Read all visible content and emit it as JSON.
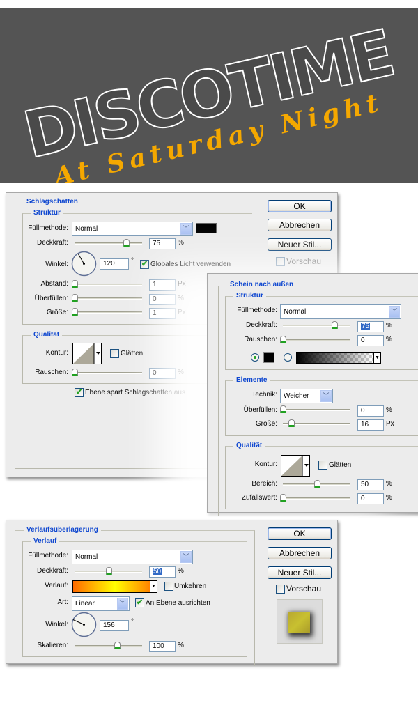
{
  "banner": {
    "title": "DISCOTIME",
    "subtitle": "At Saturday Night",
    "bg_color": "#545454",
    "subtitle_color": "#f5a800"
  },
  "buttons": {
    "ok": "OK",
    "cancel": "Abbrechen",
    "new_style": "Neuer Stil...",
    "preview": "Vorschau"
  },
  "drop_shadow": {
    "title": "Schlagschatten",
    "structure": "Struktur",
    "blend_mode_label": "Füllmethode:",
    "blend_mode": "Normal",
    "color": "#000000",
    "opacity_label": "Deckkraft:",
    "opacity": "75",
    "opacity_unit": "%",
    "angle_label": "Winkel:",
    "angle": "120",
    "angle_unit": "°",
    "global_light_label": "Globales Licht verwenden",
    "global_light": true,
    "distance_label": "Abstand:",
    "distance": "1",
    "distance_unit": "Px",
    "spread_label": "Überfüllen:",
    "spread": "0",
    "spread_unit": "%",
    "size_label": "Größe:",
    "size": "1",
    "size_unit": "Px",
    "quality": "Qualität",
    "contour_label": "Kontur:",
    "antialias_label": "Glätten",
    "antialias": false,
    "noise_label": "Rauschen:",
    "noise": "0",
    "noise_unit": "%",
    "knockout_label": "Ebene spart Schlagschatten aus",
    "knockout": true,
    "preview": false
  },
  "outer_glow": {
    "title": "Schein nach außen",
    "structure": "Struktur",
    "blend_mode_label": "Füllmethode:",
    "blend_mode": "Normal",
    "opacity_label": "Deckkraft:",
    "opacity": "75",
    "opacity_unit": "%",
    "noise_label": "Rauschen:",
    "noise": "0",
    "noise_unit": "%",
    "color": "#000000",
    "color_mode": "solid",
    "elements": "Elemente",
    "technique_label": "Technik:",
    "technique": "Weicher",
    "spread_label": "Überfüllen:",
    "spread": "0",
    "spread_unit": "%",
    "size_label": "Größe:",
    "size": "16",
    "size_unit": "Px",
    "quality": "Qualität",
    "contour_label": "Kontur:",
    "antialias_label": "Glätten",
    "antialias": false,
    "range_label": "Bereich:",
    "range": "50",
    "range_unit": "%",
    "jitter_label": "Zufallswert:",
    "jitter": "0",
    "jitter_unit": "%"
  },
  "gradient_overlay": {
    "title": "Verlaufsüberlagerung",
    "group": "Verlauf",
    "blend_mode_label": "Füllmethode:",
    "blend_mode": "Normal",
    "opacity_label": "Deckkraft:",
    "opacity": "50",
    "opacity_unit": "%",
    "gradient_label": "Verlauf:",
    "gradient_colors": [
      "#ff6a00",
      "#ffff00",
      "#ff6a00"
    ],
    "reverse_label": "Umkehren",
    "reverse": false,
    "style_label": "Art:",
    "style": "Linear",
    "align_label": "An Ebene ausrichten",
    "align": true,
    "angle_label": "Winkel:",
    "angle": "156",
    "angle_unit": "°",
    "scale_label": "Skalieren:",
    "scale": "100",
    "scale_unit": "%",
    "preview": false
  }
}
